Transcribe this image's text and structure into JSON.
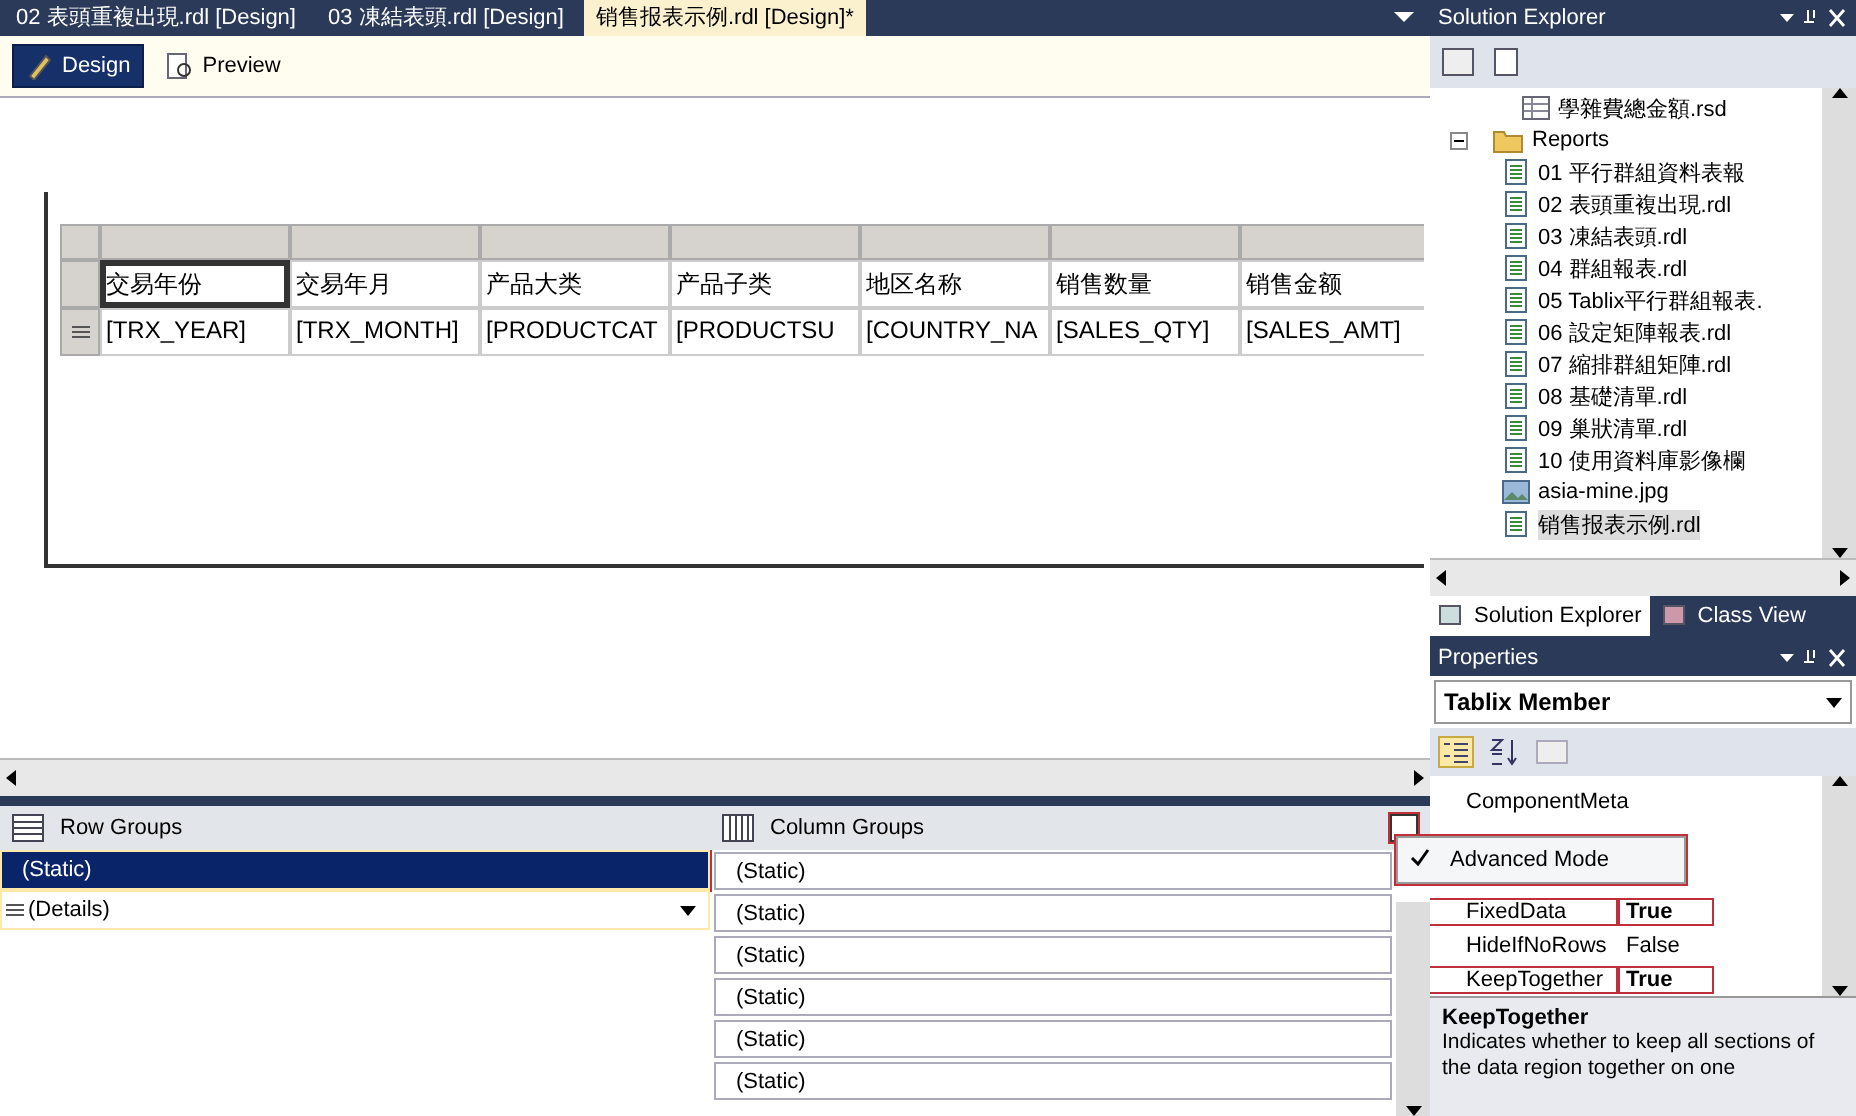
{
  "doc_tabs": [
    {
      "label": "02 表頭重複出現.rdl [Design]",
      "selected": false
    },
    {
      "label": "03 凍結表頭.rdl [Design]",
      "selected": false
    },
    {
      "label": "销售报表示例.rdl [Design]*",
      "selected": true
    }
  ],
  "view_tabs": [
    {
      "label": "Design",
      "selected": true
    },
    {
      "label": "Preview",
      "selected": false
    }
  ],
  "tablix": {
    "columns": [
      {
        "header": "交易年份",
        "field": "[TRX_YEAR]",
        "selected": true
      },
      {
        "header": "交易年月",
        "field": "[TRX_MONTH]",
        "selected": false
      },
      {
        "header": "产品大类",
        "field": "[PRODUCTCAT",
        "selected": false
      },
      {
        "header": "产品子类",
        "field": "[PRODUCTSU",
        "selected": false
      },
      {
        "header": "地区名称",
        "field": "[COUNTRY_NA",
        "selected": false
      },
      {
        "header": "销售数量",
        "field": "[SALES_QTY]",
        "selected": false
      },
      {
        "header": "销售金额",
        "field": "[SALES_AMT]",
        "selected": false
      }
    ]
  },
  "row_groups": {
    "title": "Row Groups",
    "items": [
      {
        "label": "(Static)",
        "kind": "static",
        "selected": true,
        "highlighted": true
      },
      {
        "label": "(Details)",
        "kind": "details",
        "selected": false,
        "highlighted": false
      }
    ]
  },
  "column_groups": {
    "title": "Column Groups",
    "mode_button_highlighted": true,
    "items": [
      {
        "label": "(Static)"
      },
      {
        "label": "(Static)"
      },
      {
        "label": "(Static)"
      },
      {
        "label": "(Static)"
      },
      {
        "label": "(Static)"
      },
      {
        "label": "(Static)"
      }
    ]
  },
  "context_menu": {
    "items": [
      {
        "label": "Advanced Mode",
        "checked": true,
        "highlighted": true
      }
    ]
  },
  "solution_explorer": {
    "title": "Solution Explorer",
    "items": [
      {
        "label": "學雜費總金額.rsd",
        "kind": "dataset",
        "selected": false
      },
      {
        "label": "Reports",
        "kind": "folder",
        "expanded": true,
        "selected": false,
        "children": [
          {
            "label": "01 平行群組資料表報",
            "kind": "report",
            "selected": false
          },
          {
            "label": "02 表頭重複出現.rdl",
            "kind": "report",
            "selected": false
          },
          {
            "label": "03 凍結表頭.rdl",
            "kind": "report",
            "selected": false
          },
          {
            "label": "04 群組報表.rdl",
            "kind": "report",
            "selected": false
          },
          {
            "label": "05 Tablix平行群組報表.",
            "kind": "report",
            "selected": false
          },
          {
            "label": "06 設定矩陣報表.rdl",
            "kind": "report",
            "selected": false
          },
          {
            "label": "07 縮排群組矩陣.rdl",
            "kind": "report",
            "selected": false
          },
          {
            "label": "08 基礎清單.rdl",
            "kind": "report",
            "selected": false
          },
          {
            "label": "09 巢狀清單.rdl",
            "kind": "report",
            "selected": false
          },
          {
            "label": "10 使用資料庫影像欄",
            "kind": "report",
            "selected": false
          },
          {
            "label": "asia-mine.jpg",
            "kind": "image",
            "selected": false
          },
          {
            "label": "销售报表示例.rdl",
            "kind": "report",
            "selected": true
          }
        ]
      }
    ],
    "bottom_tabs": [
      {
        "label": "Solution Explorer",
        "selected": true
      },
      {
        "label": "Class View",
        "selected": false
      }
    ]
  },
  "properties": {
    "title": "Properties",
    "object": "Tablix Member",
    "rows": [
      {
        "name": "ComponentMeta",
        "highlighted": false
      },
      {
        "name": "FixedData",
        "value": "True",
        "modified": true,
        "highlighted": true
      },
      {
        "name": "HideIfNoRows",
        "value": "False",
        "modified": false,
        "highlighted": false
      },
      {
        "name": "KeepTogether",
        "value": "True",
        "modified": true,
        "highlighted": true
      }
    ],
    "description_title": "KeepTogether",
    "description": "Indicates whether to keep all sections of the data region together on one"
  }
}
